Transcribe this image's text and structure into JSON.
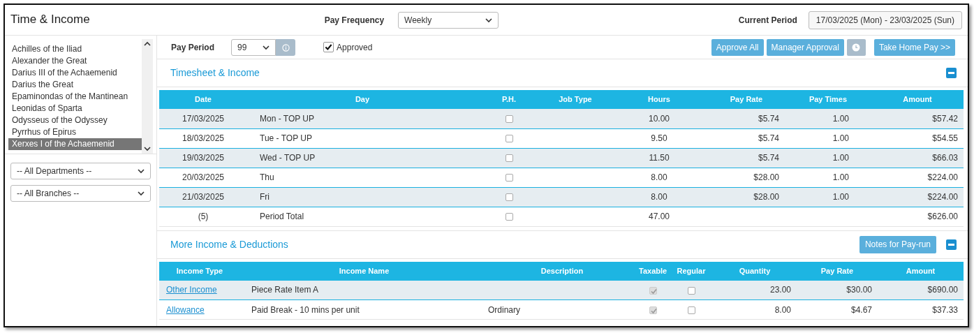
{
  "header": {
    "title": "Time & Income",
    "pay_frequency_label": "Pay Frequency",
    "pay_frequency": "Weekly",
    "current_period_label": "Current Period",
    "current_period": "17/03/2025 (Mon) - 23/03/2025 (Sun)"
  },
  "employees": [
    {
      "name": "Achilles of the Iliad",
      "selected": false
    },
    {
      "name": "Alexander the Great",
      "selected": false
    },
    {
      "name": "Darius III of the Achaemenid",
      "selected": false
    },
    {
      "name": "Darius the Great",
      "selected": false
    },
    {
      "name": "Epaminondas of the Mantinean",
      "selected": false
    },
    {
      "name": "Leonidas of Sparta",
      "selected": false
    },
    {
      "name": "Odysseus of the Odyssey",
      "selected": false
    },
    {
      "name": "Pyrrhus of Epirus",
      "selected": false
    },
    {
      "name": "Xerxes I of the Achaemenid",
      "selected": true
    }
  ],
  "filters": [
    {
      "value": "-- All Departments --"
    },
    {
      "value": "-- All Branches --"
    }
  ],
  "toolbar": {
    "pay_period_label": "Pay Period",
    "pay_period": "99",
    "approved_label": "Approved",
    "approved": true,
    "buttons": [
      {
        "kind": "text",
        "label": "Approve All",
        "disabled": false
      },
      {
        "kind": "text",
        "label": "Manager Approval",
        "disabled": false
      },
      {
        "kind": "clock",
        "disabled": true
      },
      {
        "kind": "text",
        "label": "Take Home Pay >>",
        "disabled": false
      }
    ]
  },
  "timesheet": {
    "title": "Timesheet & Income",
    "expanded": true,
    "columns": [
      "Date",
      "Day",
      "P.H.",
      "Job Type",
      "Hours",
      "Pay Rate",
      "Pay Times",
      "Amount"
    ],
    "rows": [
      {
        "date": "17/03/2025",
        "day": "Mon - TOP UP",
        "ph": false,
        "hours": "10.00",
        "pay_rate": "$5.74",
        "pay_times": "1.00",
        "amount": "$57.42"
      },
      {
        "date": "18/03/2025",
        "day": "Tue - TOP UP",
        "ph": false,
        "hours": "9.50",
        "pay_rate": "$5.74",
        "pay_times": "1.00",
        "amount": "$54.55"
      },
      {
        "date": "19/03/2025",
        "day": "Wed - TOP UP",
        "ph": false,
        "hours": "11.50",
        "pay_rate": "$5.74",
        "pay_times": "1.00",
        "amount": "$66.03"
      },
      {
        "date": "20/03/2025",
        "day": "Thu",
        "ph": false,
        "hours": "8.00",
        "pay_rate": "$28.00",
        "pay_times": "1.00",
        "amount": "$224.00"
      },
      {
        "date": "21/03/2025",
        "day": "Fri",
        "ph": false,
        "hours": "8.00",
        "pay_rate": "$28.00",
        "pay_times": "1.00",
        "amount": "$224.00"
      }
    ],
    "total": {
      "count": "(5)",
      "label": "Period Total",
      "ph": false,
      "hours": "47.00",
      "amount": "$626.00"
    }
  },
  "income": {
    "title": "More Income & Deductions",
    "notes_button": "Notes for Pay-run",
    "expanded": true,
    "columns": [
      "Income Type",
      "Income Name",
      "Description",
      "Taxable",
      "Regular",
      "Quantity",
      "Pay Rate",
      "Amount"
    ],
    "rows": [
      {
        "income_type": "Other Income",
        "income_name": "Piece Rate Item A",
        "taxable": true,
        "regular": false,
        "quantity": "23.00",
        "pay_rate": "$30.00",
        "amount": "$690.00"
      },
      {
        "income_type": "Allowance",
        "income_name": "Paid Break - 10 mins per unit",
        "description": "Ordinary",
        "taxable": true,
        "regular": false,
        "quantity": "8.00",
        "pay_rate": "$4.67",
        "amount": "$37.33"
      }
    ]
  }
}
